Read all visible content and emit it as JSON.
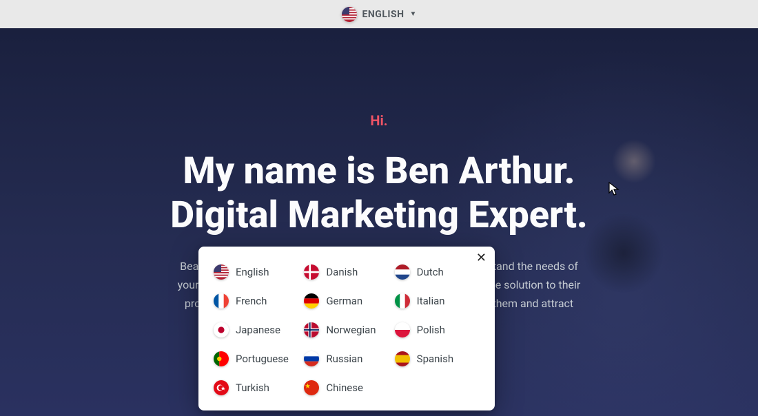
{
  "topbar": {
    "language_label": "ENGLISH",
    "caret": "▼",
    "flag": "us"
  },
  "hero": {
    "hi": "Hi.",
    "headline": "My name is Ben Arthur.\nDigital Marketing Expert.",
    "sub": "Beautifully simple follow-along-videos to help you deeply understand the needs of\nyour visitors. Your website must offer them an immediate valuable solution to their\nproblems. This is how you create meaningful connections with them and attract sales"
  },
  "modal": {
    "close_label": "✕",
    "languages": [
      {
        "code": "us",
        "label": "English"
      },
      {
        "code": "dk",
        "label": "Danish"
      },
      {
        "code": "nl",
        "label": "Dutch"
      },
      {
        "code": "fr",
        "label": "French"
      },
      {
        "code": "de",
        "label": "German"
      },
      {
        "code": "it",
        "label": "Italian"
      },
      {
        "code": "jp",
        "label": "Japanese"
      },
      {
        "code": "no",
        "label": "Norwegian"
      },
      {
        "code": "pl",
        "label": "Polish"
      },
      {
        "code": "pt",
        "label": "Portuguese"
      },
      {
        "code": "ru",
        "label": "Russian"
      },
      {
        "code": "es",
        "label": "Spanish"
      },
      {
        "code": "tr",
        "label": "Turkish"
      },
      {
        "code": "cn",
        "label": "Chinese"
      }
    ]
  }
}
